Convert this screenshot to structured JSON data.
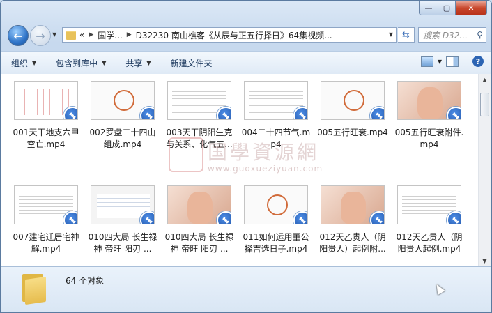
{
  "window": {
    "caption_buttons": {
      "minimize": "—",
      "maximize": "▢",
      "close": "✕"
    }
  },
  "nav": {
    "breadcrumb_prefix": "«",
    "breadcrumb": [
      "国学...",
      "D32230 南山樵客《从辰与正五行择日》64集视频..."
    ],
    "search_placeholder": "搜索 D32..."
  },
  "toolbar": {
    "organize": "组织",
    "include_library": "包含到库中",
    "share": "共享",
    "new_folder": "新建文件夹"
  },
  "files": [
    {
      "name": "001天干地支六甲空亡.mp4",
      "thumb": "redtable"
    },
    {
      "name": "002罗盘二十四山组成.mp4",
      "thumb": "circle"
    },
    {
      "name": "003天干阴阳生克与关系、化气五...",
      "thumb": "doc"
    },
    {
      "name": "004二十四节气.mp4",
      "thumb": "doc"
    },
    {
      "name": "005五行旺衰.mp4",
      "thumb": "circle"
    },
    {
      "name": "005五行旺衰附件.mp4",
      "thumb": "hand"
    },
    {
      "name": "007建宅迁居宅神解.mp4",
      "thumb": "doc"
    },
    {
      "name": "010四大局 长生禄神 帝旺 阳刃 ...",
      "thumb": "spread"
    },
    {
      "name": "010四大局 长生禄神 帝旺 阳刃 ...",
      "thumb": "hand"
    },
    {
      "name": "011如何运用董公择吉选日子.mp4",
      "thumb": "circle"
    },
    {
      "name": "012天乙贵人（阴阳贵人）起例附...",
      "thumb": "hand"
    },
    {
      "name": "012天乙贵人（阴阳贵人起例.mp4",
      "thumb": "doc"
    }
  ],
  "watermark": {
    "text": "国學資源網",
    "url": "www.guoxueziyuan.com"
  },
  "status": {
    "count": "64 个对象"
  }
}
